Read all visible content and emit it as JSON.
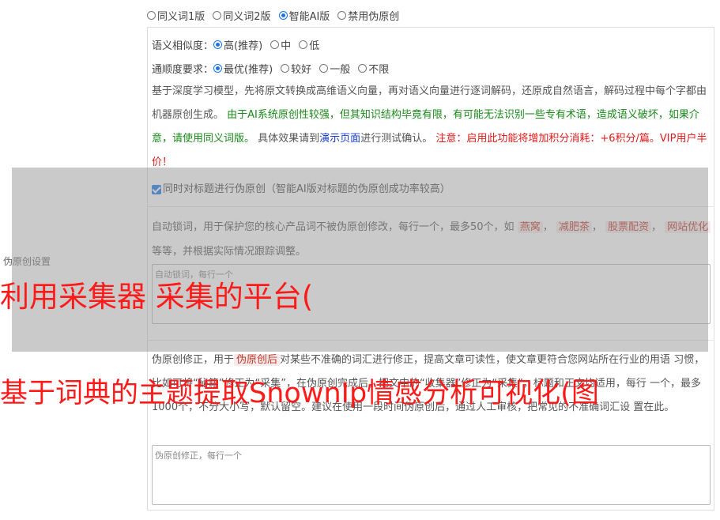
{
  "mode_options": [
    {
      "label": "同义词1版",
      "selected": false
    },
    {
      "label": "同义词2版",
      "selected": false
    },
    {
      "label": "智能AI版",
      "selected": true
    },
    {
      "label": "禁用伪原创",
      "selected": false
    }
  ],
  "similarity": {
    "label": "语义相似度：",
    "options": [
      {
        "label": "高(推荐)",
        "selected": true
      },
      {
        "label": "中",
        "selected": false
      },
      {
        "label": "低",
        "selected": false
      }
    ]
  },
  "fluency": {
    "label": "通顺度要求：",
    "options": [
      {
        "label": "最优(推荐)",
        "selected": true
      },
      {
        "label": "较好",
        "selected": false
      },
      {
        "label": "一般",
        "selected": false
      },
      {
        "label": "不限",
        "selected": false
      }
    ]
  },
  "description": {
    "part1": "基于深度学习模型，先将原文转换成高维语义向量，再对语义向量进行逐词解码，还原成自然语言，解码过程中每个字都由机器原创生成。",
    "part2": "由于AI系统原创性较强，但其知识结构毕竟有限，有可能无法识别一些专有术语，造成语义破坏，如果介意，请使用同义词版。",
    "part3": "具体效果请到",
    "link": "演示页面",
    "part4": "进行测试确认。",
    "part5": "注意：启用此功能将增加积分消耗：+6积分/篇。VIP用户半价！"
  },
  "title_checkbox": {
    "label": "同时对标题进行伪原创（智能AI版对标题的伪原创成功率较高）",
    "checked": true
  },
  "section_label": "伪原创设置",
  "lock_words": {
    "desc_prefix": "自动锁词，用于保护您的核心产品词不被伪原创修改，每行一个，最多50个，如",
    "tags": [
      "燕窝",
      "减肥茶",
      "股票配资",
      "网站优化"
    ],
    "desc_suffix": "等等，并根据实际情况跟踪调整。",
    "placeholder": "自动锁词，每行一个"
  },
  "correction": {
    "desc_prefix": "伪原创修正，用于",
    "tag": "伪原创后",
    "desc_line1_rest": "对某些不准确的词汇进行修正，提高文章可读性，使文章更符合您网站所在行业的用语",
    "desc_line2": "习惯，比如可将“秘籍”修正为“采集”，在伪原创完成后，把文中的“收集器”修正为“采集”，标题和正文均适用，每行",
    "desc_line3": "一个，最多1000个，不分大小写，默认留空。建议在使用一段时间伪原创后，通过人工审核，把常见的不准确词汇设",
    "desc_line4": "置在此。",
    "placeholder": "伪原创修正，每行一个"
  },
  "watermark1": "利用采集器 采集的平台(",
  "watermark2": "基于词典的主题提取SnownIp情感分析可视化(图"
}
